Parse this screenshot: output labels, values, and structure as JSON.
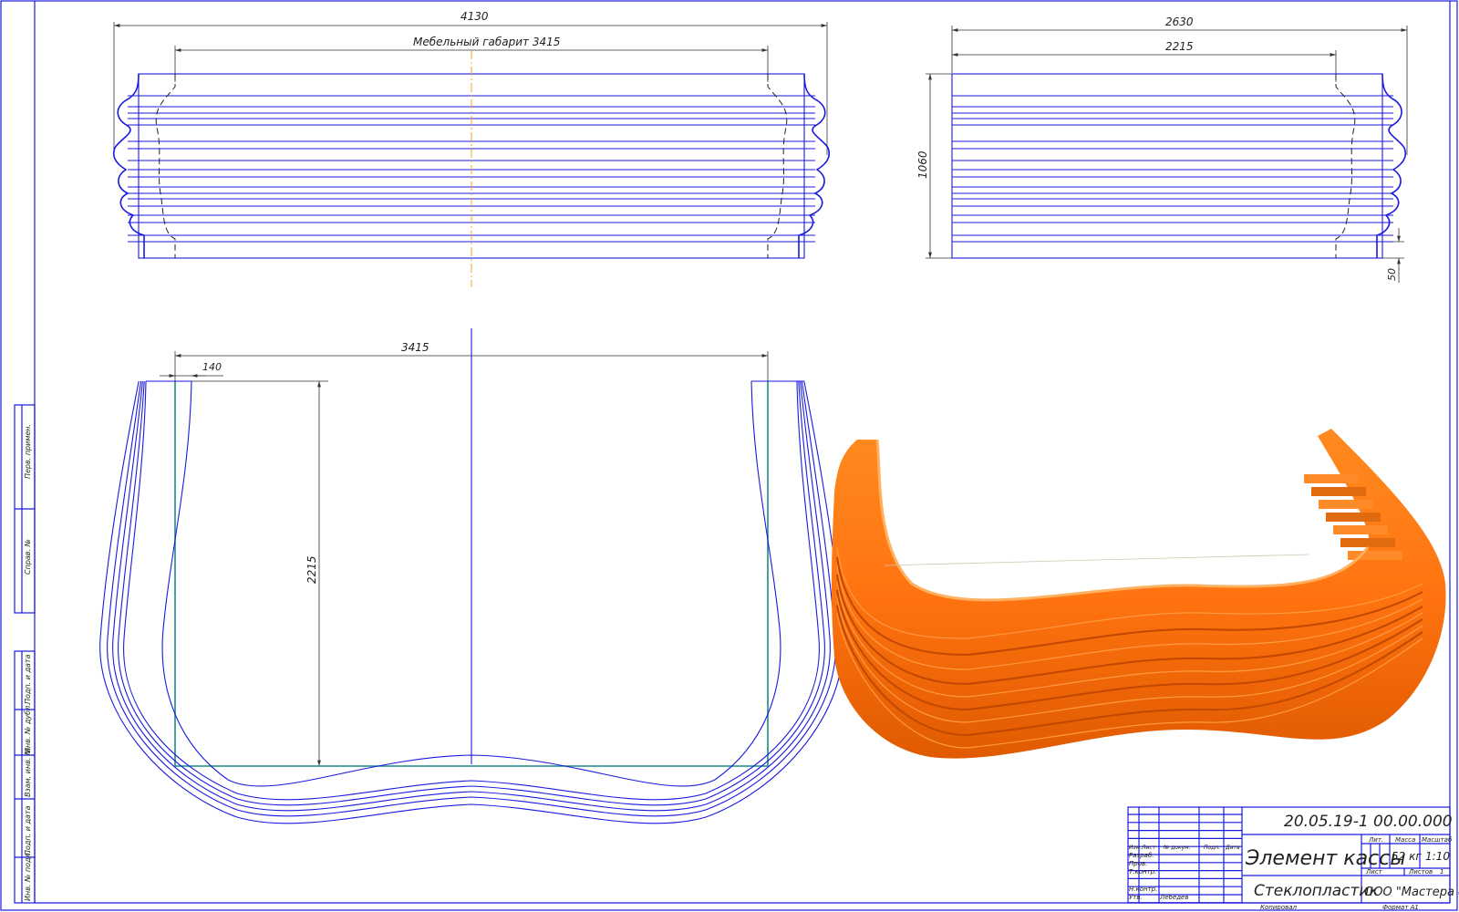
{
  "dimensions": {
    "top_overall": "4130",
    "top_inner": "Мебельный габарит  3415",
    "side_overall": "2630",
    "side_inner": "2215",
    "side_height": "1060",
    "side_base": "50",
    "plan_width": "3415",
    "plan_edge": "140",
    "plan_depth": "2215"
  },
  "title_block": {
    "designation": "20.05.19-1 00.00.000",
    "name": "Элемент кассы",
    "material": "Стеклопластик",
    "company": "ООО \"Мастера форм\"",
    "mass": "52 кг",
    "scale": "1:10",
    "col_izm": "Изм.",
    "col_list": "Лист",
    "col_doc": "№ докум.",
    "col_sign": "Подп.",
    "col_date": "Дата",
    "lit_label": "Лит.",
    "mass_label": "Масса",
    "scale_label": "Масштаб",
    "sheet_label": "Лист",
    "sheets_label": "Листов",
    "sheets_value": "1",
    "razrab": "Разраб.",
    "prov": "Пров.",
    "tkontr": "Т.контр.",
    "nkontr": "Н.контр.",
    "utv": "Утв.",
    "designer": "Лебедев",
    "copied": "Копировал",
    "format": "Формат   А1"
  },
  "side_stamp": {
    "perv_primen": "Перв. примен.",
    "sprav": "Справ. №",
    "podp_data_1": "Подп. и дата",
    "inv_dubl": "Инв. № дубл.",
    "vzam_inv": "Взам. инв. №",
    "podp_data_2": "Подп. и дата",
    "inv_podl": "Инв. № подл."
  },
  "colors": {
    "line": "#1a1adf",
    "teal": "#1a8a8a",
    "orange": "#ff7a10",
    "axis": "#f0a030"
  }
}
